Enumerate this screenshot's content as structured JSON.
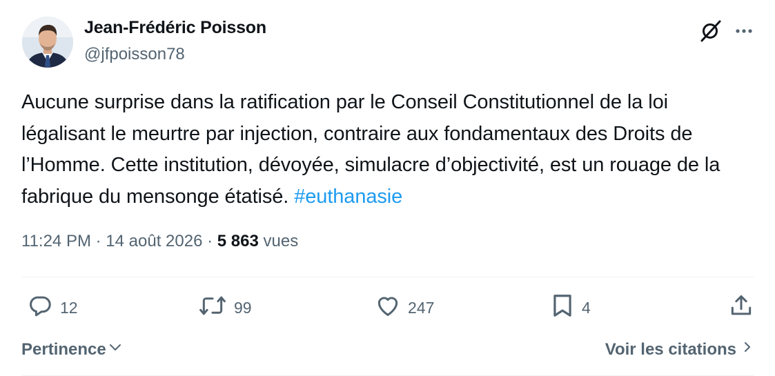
{
  "author": {
    "name": "Jean-Frédéric Poisson",
    "handle": "@jfpoisson78"
  },
  "tweet": {
    "text": "Aucune surprise dans la ratification par le Conseil Constitutionnel de la loi légalisant le meurtre par injection, contraire aux fondamentaux des Droits de l’Homme. Cette institution, dévoyée, simulacre d’objectivité, est un rouage de la fabrique du mensonge étatisé.",
    "hashtag": "#euthanasie"
  },
  "meta": {
    "time": "11:24 PM",
    "separator": "·",
    "date": "14 août 2026",
    "views_count": "5 863",
    "views_label": "vues"
  },
  "actions": {
    "replies": "12",
    "reposts": "99",
    "likes": "247",
    "bookmarks": "4"
  },
  "sort": {
    "label": "Pertinence",
    "quotes_label": "Voir les citations"
  },
  "icons": {
    "header": [
      "grok-icon",
      "more-icon"
    ],
    "actions": [
      "reply-icon",
      "repost-icon",
      "like-icon",
      "bookmark-icon",
      "share-icon"
    ]
  },
  "colors": {
    "text": "#0f1419",
    "secondary": "#536471",
    "link": "#1d9bf0",
    "divider": "#eff3f4"
  }
}
